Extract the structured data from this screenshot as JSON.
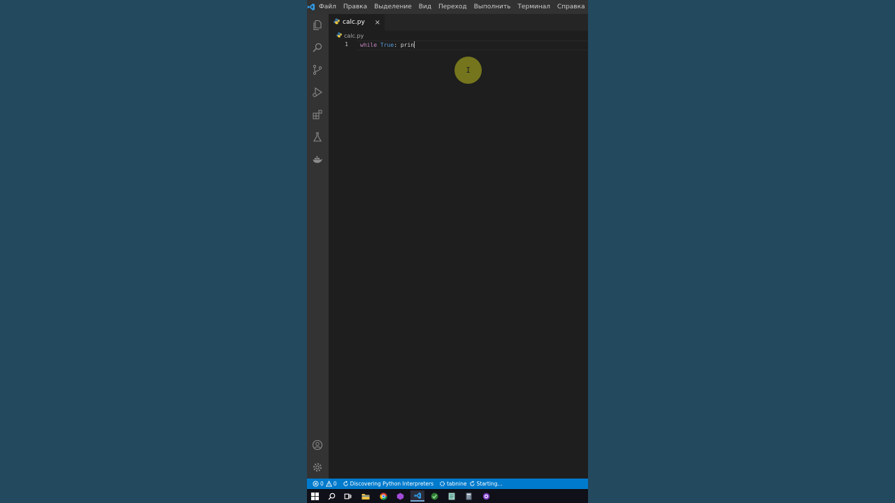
{
  "menu": {
    "items": [
      "Файл",
      "Правка",
      "Выделение",
      "Вид",
      "Переход",
      "Выполнить",
      "Терминал",
      "Справка"
    ]
  },
  "activity_bar": {
    "icons": [
      "explorer-icon",
      "search-icon",
      "source-control-icon",
      "run-debug-icon",
      "extensions-icon",
      "testing-icon",
      "docker-icon"
    ],
    "bottom_icons": [
      "accounts-icon",
      "manage-gear-icon"
    ]
  },
  "tab": {
    "label": "calc.py",
    "close": "×"
  },
  "breadcrumb": {
    "file": "calc.py"
  },
  "editor": {
    "line_number": "1",
    "code": {
      "keyword": "while",
      "constant": "True",
      "rest": ": prin"
    }
  },
  "status": {
    "errors": "0",
    "warnings": "0",
    "python": "Discovering Python Interpreters",
    "tabnine": "tabnine",
    "tabnine_status": "Starting..."
  },
  "taskbar": {
    "icons": [
      "windows-start-icon",
      "search-icon",
      "task-view-icon",
      "file-explorer-icon",
      "chrome-icon",
      "app-icon",
      "vscode-icon",
      "app-icon",
      "notes-icon",
      "calculator-icon",
      "app-icon"
    ]
  },
  "colors": {
    "background": "#23495f",
    "editor": "#1e1e1e",
    "statusbar": "#007acc",
    "keyword": "#c586c0",
    "constant": "#569cd6"
  }
}
